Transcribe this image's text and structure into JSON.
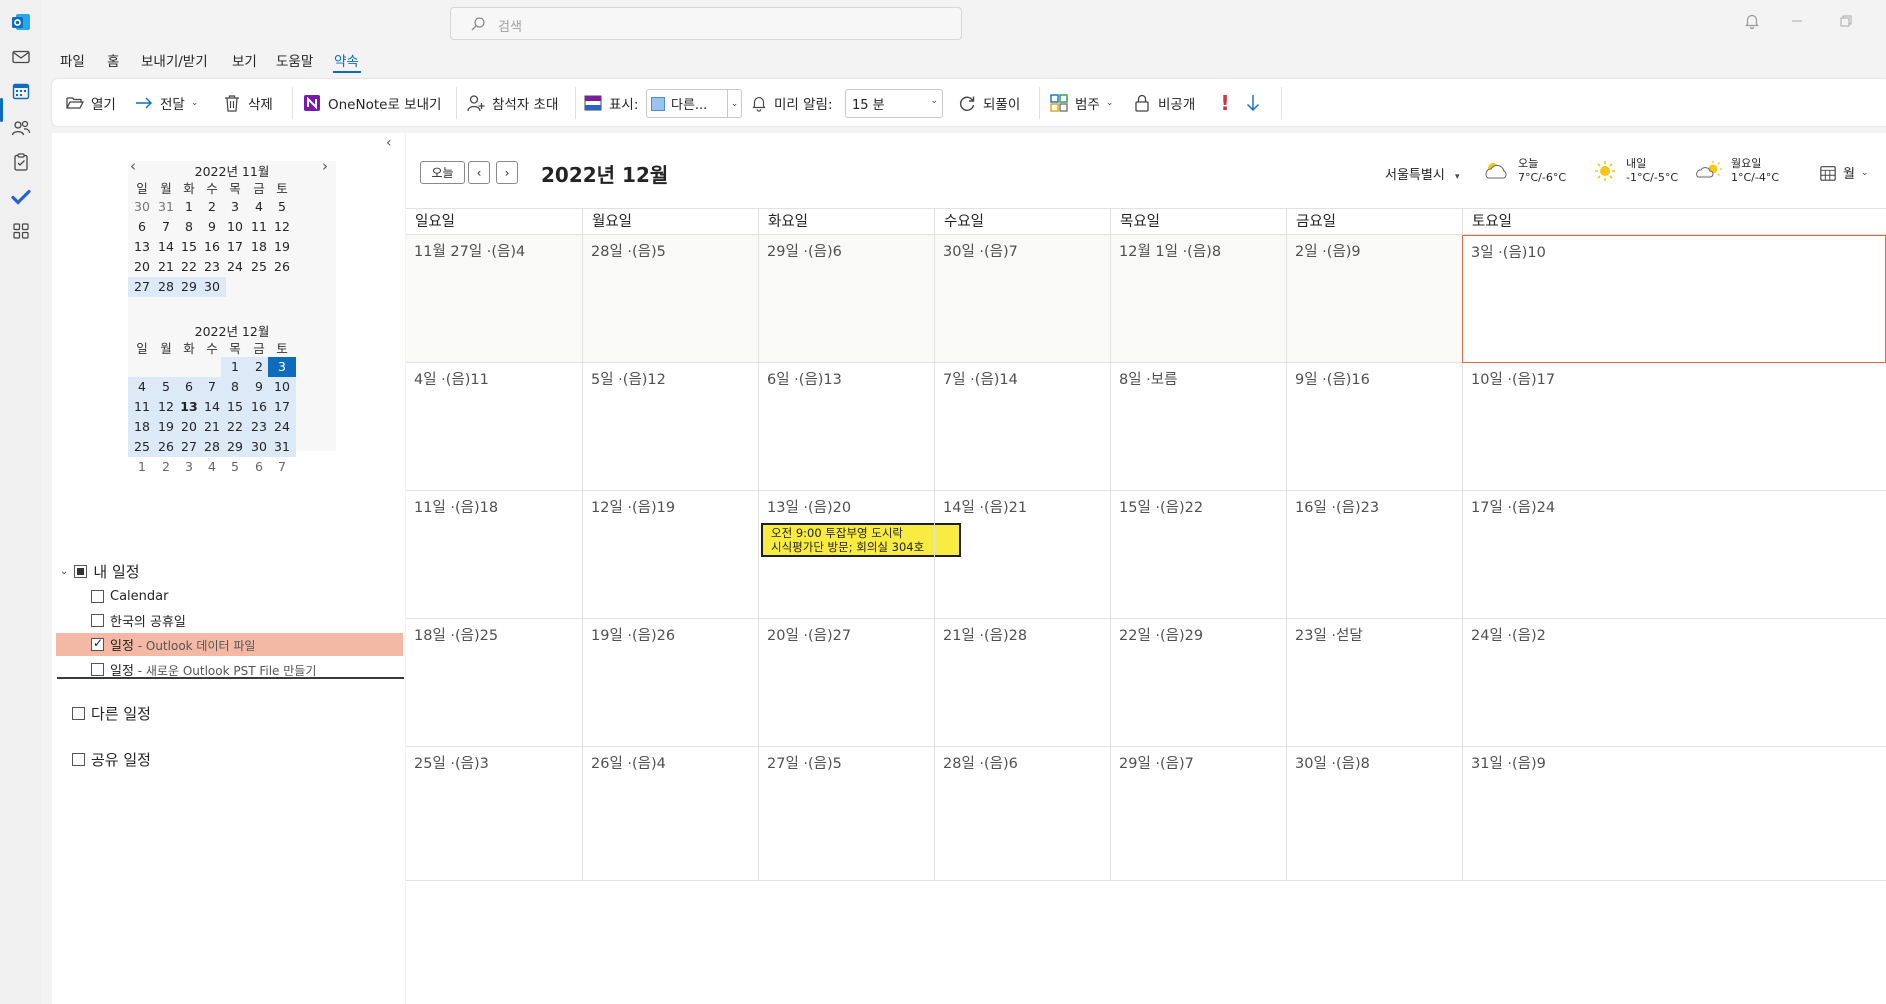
{
  "titlebar": {
    "search_placeholder": "검색"
  },
  "menu": {
    "tabs": [
      "파일",
      "홈",
      "보내기/받기",
      "보기",
      "도움말",
      "약속"
    ],
    "active_index": 5
  },
  "ribbon": {
    "open": "열기",
    "forward": "전달",
    "delete": "삭제",
    "onenote": "OneNote로 보내기",
    "invite": "참석자 초대",
    "show_as_label": "표시:",
    "show_as_value": "다른...",
    "reminder_label": "미리 알림:",
    "reminder_value": "15 분",
    "recurrence": "되풀이",
    "categorize": "범주",
    "private": "비공개"
  },
  "mini_calendars": [
    {
      "title": "2022년 11월",
      "dow": [
        "일",
        "월",
        "화",
        "수",
        "목",
        "금",
        "토"
      ],
      "weeks": [
        [
          "30",
          "31",
          "1",
          "2",
          "3",
          "4",
          "5"
        ],
        [
          "6",
          "7",
          "8",
          "9",
          "10",
          "11",
          "12"
        ],
        [
          "13",
          "14",
          "15",
          "16",
          "17",
          "18",
          "19"
        ],
        [
          "20",
          "21",
          "22",
          "23",
          "24",
          "25",
          "26"
        ],
        [
          "27",
          "28",
          "29",
          "30",
          "",
          "",
          ""
        ]
      ]
    },
    {
      "title": "2022년 12월",
      "dow": [
        "일",
        "월",
        "화",
        "수",
        "목",
        "금",
        "토"
      ],
      "weeks": [
        [
          "",
          "",
          "",
          "",
          "1",
          "2",
          "3"
        ],
        [
          "4",
          "5",
          "6",
          "7",
          "8",
          "9",
          "10"
        ],
        [
          "11",
          "12",
          "13",
          "14",
          "15",
          "16",
          "17"
        ],
        [
          "18",
          "19",
          "20",
          "21",
          "22",
          "23",
          "24"
        ],
        [
          "25",
          "26",
          "27",
          "28",
          "29",
          "30",
          "31"
        ],
        [
          "1",
          "2",
          "3",
          "4",
          "5",
          "6",
          "7"
        ]
      ]
    }
  ],
  "calendars": {
    "my_group": "내 일정",
    "items": [
      {
        "name": "Calendar",
        "sub": "",
        "checked": false
      },
      {
        "name": "한국의 공휴일",
        "sub": "",
        "checked": false
      },
      {
        "name": "일정",
        "sub": " - Outlook 데이터 파일",
        "checked": true
      },
      {
        "name": "일정",
        "sub": " - 새로운 Outlook PST File 만들기",
        "checked": false
      }
    ],
    "other_group": "다른 일정",
    "shared_group": "공유 일정"
  },
  "main": {
    "today_button": "오늘",
    "month_title": "2022년 12월",
    "location": "서울특별시",
    "weather": [
      {
        "day": "오늘",
        "temp": "7°C/-6°C",
        "icon": "partly-cloudy-icon"
      },
      {
        "day": "내일",
        "temp": "-1°C/-5°C",
        "icon": "sun-icon"
      },
      {
        "day": "월요일",
        "temp": "1°C/-4°C",
        "icon": "cloud-sun-icon"
      }
    ],
    "view_label": "월",
    "dow": [
      "일요일",
      "월요일",
      "화요일",
      "수요일",
      "목요일",
      "금요일",
      "토요일"
    ],
    "weeks": [
      [
        "11월 27일 ·(음)4",
        "28일 ·(음)5",
        "29일 ·(음)6",
        "30일 ·(음)7",
        "12월 1일 ·(음)8",
        "2일 ·(음)9",
        "3일 ·(음)10"
      ],
      [
        "4일 ·(음)11",
        "5일 ·(음)12",
        "6일 ·(음)13",
        "7일 ·(음)14",
        "8일 ·보름",
        "9일 ·(음)16",
        "10일 ·(음)17"
      ],
      [
        "11일 ·(음)18",
        "12일 ·(음)19",
        "13일 ·(음)20",
        "14일 ·(음)21",
        "15일 ·(음)22",
        "16일 ·(음)23",
        "17일 ·(음)24"
      ],
      [
        "18일 ·(음)25",
        "19일 ·(음)26",
        "20일 ·(음)27",
        "21일 ·(음)28",
        "22일 ·(음)29",
        "23일 ·섣달",
        "24일 ·(음)2"
      ],
      [
        "25일 ·(음)3",
        "26일 ·(음)4",
        "27일 ·(음)5",
        "28일 ·(음)6",
        "29일 ·(음)7",
        "30일 ·(음)8",
        "31일 ·(음)9"
      ]
    ],
    "event": {
      "line1": "오전 9:00 투잡부영 도시락",
      "line2": "시식평가단 방문; 회의실 304호"
    }
  },
  "colors": {
    "accent": "#0f6cbd",
    "event_bg": "#f8ec42",
    "selected_calendar": "#f3b9a4",
    "today_border": "#d86b45"
  }
}
